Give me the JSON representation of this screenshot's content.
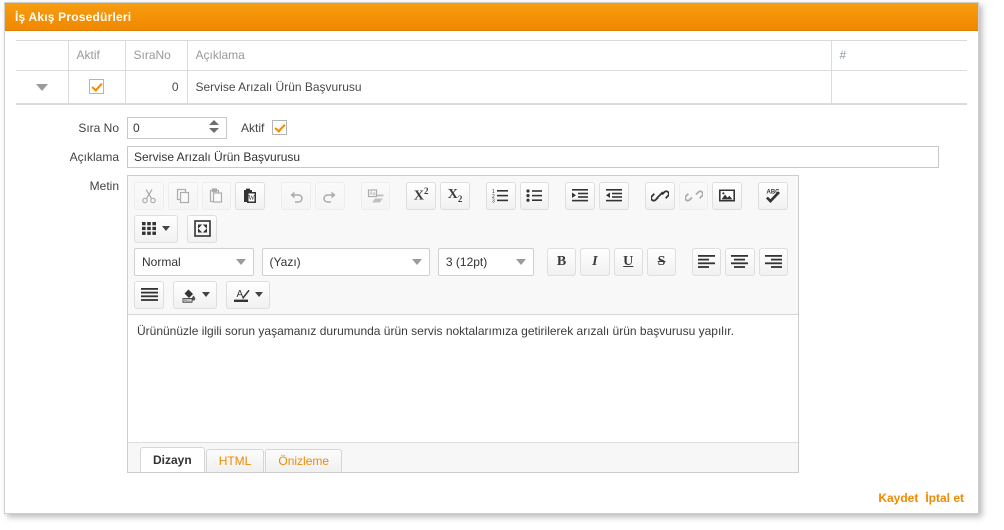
{
  "window": {
    "title": "İş Akış Prosedürleri",
    "accent_color": "#f08a00"
  },
  "grid": {
    "columns": [
      {
        "key": "expander",
        "label": ""
      },
      {
        "key": "aktif",
        "label": "Aktif"
      },
      {
        "key": "sirano",
        "label": "SıraNo"
      },
      {
        "key": "aciklama",
        "label": "Açıklama"
      },
      {
        "key": "hash",
        "label": "#"
      }
    ],
    "rows": [
      {
        "expander": "expand-row-icon",
        "aktif": true,
        "sirano": "0",
        "aciklama": "Servise Arızalı Ürün Başvurusu",
        "hash": ""
      }
    ]
  },
  "form": {
    "sirano": {
      "label": "Sıra No",
      "value": "0"
    },
    "aktif": {
      "label": "Aktif",
      "checked": true
    },
    "aciklama": {
      "label": "Açıklama",
      "value": "Servise Arızalı Ürün Başvurusu",
      "placeholder": ""
    },
    "metin": {
      "label": "Metin"
    }
  },
  "editor": {
    "toolbar": {
      "row1": [
        {
          "name": "cut-icon",
          "title": "Kes",
          "disabled": true
        },
        {
          "name": "copy-icon",
          "title": "Kopyala",
          "disabled": true
        },
        {
          "name": "paste-icon",
          "title": "Yapıştır",
          "disabled": true
        },
        {
          "name": "paste-from-word-icon",
          "title": "Word'den Yapıştır",
          "disabled": false
        },
        {
          "name": "undo-icon",
          "title": "Geri Al",
          "disabled": true
        },
        {
          "name": "redo-icon",
          "title": "Yinele",
          "disabled": true
        },
        {
          "name": "remove-format-icon",
          "title": "Biçimi Temizle",
          "disabled": true
        },
        {
          "name": "superscript-icon",
          "title": "Üst Simge",
          "label": "x2",
          "disabled": false
        },
        {
          "name": "subscript-icon",
          "title": "Alt Simge",
          "label": "x2",
          "disabled": false
        },
        {
          "name": "numbered-list-icon",
          "title": "Numaralı Liste",
          "disabled": false
        },
        {
          "name": "bulleted-list-icon",
          "title": "Madde İşaretli Liste",
          "disabled": false
        },
        {
          "name": "indent-icon",
          "title": "Girintiyi Artır",
          "disabled": false
        },
        {
          "name": "outdent-icon",
          "title": "Girintiyi Azalt",
          "disabled": false
        },
        {
          "name": "link-icon",
          "title": "Bağlantı",
          "disabled": false
        },
        {
          "name": "unlink-icon",
          "title": "Bağlantıyı Kaldır",
          "disabled": true
        },
        {
          "name": "image-icon",
          "title": "Resim",
          "disabled": false
        },
        {
          "name": "spellcheck-icon",
          "title": "Yazım Denetimi",
          "label": "ABC",
          "disabled": false
        }
      ],
      "row2": [
        {
          "name": "table-icon",
          "title": "Tablo",
          "has_dropdown": true
        },
        {
          "name": "fullscreen-icon",
          "title": "Tam Ekran",
          "has_dropdown": false
        }
      ],
      "selects": [
        {
          "name": "paragraph-format-select",
          "value": "Normal"
        },
        {
          "name": "font-family-select",
          "value": "(Yazı)"
        },
        {
          "name": "font-size-select",
          "value": "3 (12pt)"
        }
      ],
      "row3_buttons": [
        {
          "name": "bold-icon",
          "label": "B"
        },
        {
          "name": "italic-icon",
          "label": "I"
        },
        {
          "name": "underline-icon",
          "label": "U"
        },
        {
          "name": "strikethrough-icon",
          "label": "S"
        },
        {
          "name": "align-left-icon",
          "label": ""
        },
        {
          "name": "align-center-icon",
          "label": ""
        },
        {
          "name": "align-right-icon",
          "label": ""
        }
      ],
      "row4": [
        {
          "name": "align-justify-icon",
          "has_dropdown": false
        },
        {
          "name": "background-color-icon",
          "has_dropdown": true
        },
        {
          "name": "text-color-icon",
          "has_dropdown": true
        }
      ]
    },
    "content": "Ürününüzle ilgili sorun yaşamanız durumunda ürün servis noktalarımıza getirilerek arızalı ürün başvurusu yapılır.",
    "tabs": [
      {
        "label": "Dizayn",
        "active": true
      },
      {
        "label": "HTML",
        "active": false
      },
      {
        "label": "Önizleme",
        "active": false
      }
    ]
  },
  "footer": {
    "save": "Kaydet",
    "cancel": "İptal et"
  }
}
